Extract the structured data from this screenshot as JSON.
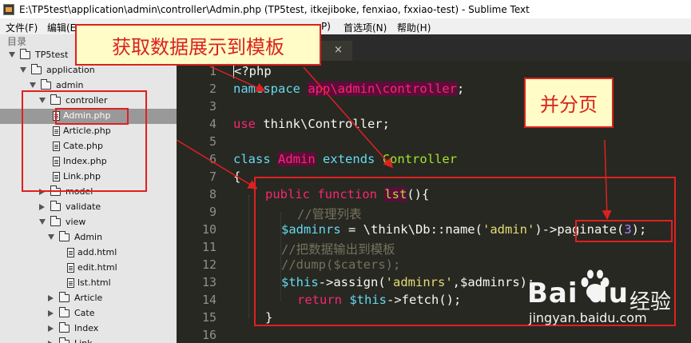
{
  "window": {
    "title": "E:\\TP5test\\application\\admin\\controller\\Admin.php (TP5test, itkejiboke, fenxiao, fxxiao-test) - Sublime Text"
  },
  "menu": {
    "file": "文件(F)",
    "edit": "编辑(E",
    "prefs_tail": "P)",
    "preferences": "首选项(N)",
    "help": "帮助(H)"
  },
  "sidebar": {
    "label": "目录",
    "items": [
      {
        "label": "TP5test",
        "type": "folder",
        "open": true,
        "level": 0
      },
      {
        "label": "application",
        "type": "folder",
        "open": true,
        "level": 1
      },
      {
        "label": "admin",
        "type": "folder",
        "open": true,
        "level": 2
      },
      {
        "label": "controller",
        "type": "folder",
        "open": true,
        "level": 3
      },
      {
        "label": "Admin.php",
        "type": "file",
        "level": 4,
        "selected": true
      },
      {
        "label": "Article.php",
        "type": "file",
        "level": 4
      },
      {
        "label": "Cate.php",
        "type": "file",
        "level": 4
      },
      {
        "label": "Index.php",
        "type": "file",
        "level": 4
      },
      {
        "label": "Link.php",
        "type": "file",
        "level": 4
      },
      {
        "label": "model",
        "type": "folder",
        "open": false,
        "level": 3
      },
      {
        "label": "validate",
        "type": "folder",
        "open": false,
        "level": 3
      },
      {
        "label": "view",
        "type": "folder",
        "open": true,
        "level": 3
      },
      {
        "label": "Admin",
        "type": "folder",
        "open": true,
        "level": 4
      },
      {
        "label": "add.html",
        "type": "file",
        "level": 5
      },
      {
        "label": "edit.html",
        "type": "file",
        "level": 5
      },
      {
        "label": "lst.html",
        "type": "file",
        "level": 5
      },
      {
        "label": "Article",
        "type": "folder",
        "open": false,
        "level": 4
      },
      {
        "label": "Cate",
        "type": "folder",
        "open": false,
        "level": 4
      },
      {
        "label": "Index",
        "type": "folder",
        "open": false,
        "level": 4
      },
      {
        "label": "Link",
        "type": "folder",
        "open": false,
        "level": 4
      }
    ]
  },
  "tab": {
    "close_icon": "×"
  },
  "editor": {
    "line_numbers": [
      "1",
      "2",
      "3",
      "4",
      "5",
      "6",
      "7",
      "8",
      "9",
      "10",
      "11",
      "12",
      "13",
      "14",
      "15",
      "16"
    ],
    "lines": {
      "l1": "<?php",
      "l2_kw": "namespace",
      "l2_ns": "app\\admin\\controller",
      "l2_semi": ";",
      "l4_kw": "use",
      "l4_rest": " think\\Controller;",
      "l6_kw": "class",
      "l6_name": "Admin",
      "l6_ext": "extends",
      "l6_parent": "Controller",
      "l7": "{",
      "l8_pub": "public",
      "l8_fn": "function",
      "l8_name": "lst",
      "l8_rest": "(){",
      "l9": "//管理列表",
      "l10_var": "$adminrs",
      "l10_a": " = \\think\\Db::",
      "l10_b": "name(",
      "l10_str": "'admin'",
      "l10_c": ")->",
      "l10_pg": "paginate(",
      "l10_num": "3",
      "l10_end": ");",
      "l11": "//把数据输出到模板",
      "l12": "//dump($caters);",
      "l13_this": "$this",
      "l13_a": "->assign(",
      "l13_str": "'adminrs'",
      "l13_b": ",$adminrs);",
      "l14_ret": "return",
      "l14_this": "$this",
      "l14_b": "->fetch();",
      "l15": "}"
    }
  },
  "annotations": {
    "main": "获取数据展示到模板",
    "paginate": "并分页"
  },
  "watermark": {
    "brand": "Bai  du",
    "jingyan": "经验",
    "url": "jingyan.baidu.com"
  },
  "colors": {
    "annotation_red": "#d9231d",
    "annotation_bg": "#fffcc8",
    "editor_bg": "#272822",
    "keyword": "#f92672",
    "storage": "#66d9ef",
    "class_name": "#a6e22e",
    "string": "#e6db74",
    "comment": "#75715e",
    "number": "#ae81ff"
  }
}
